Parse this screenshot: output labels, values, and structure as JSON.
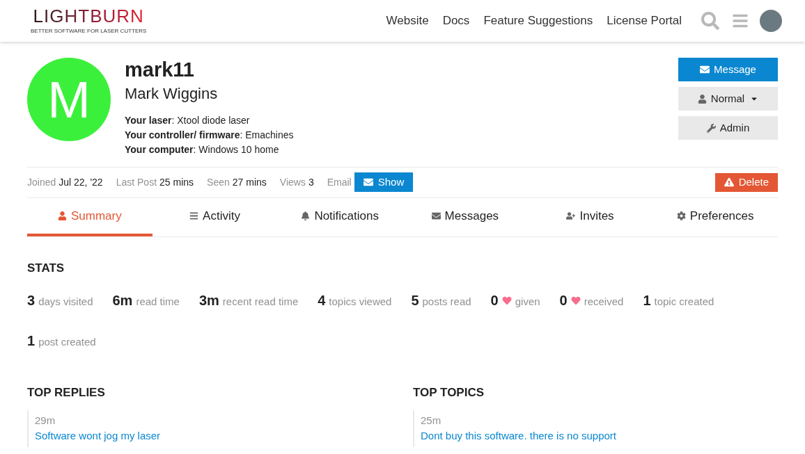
{
  "header": {
    "logo": {
      "name": "LIGHTBURN",
      "tagline": "BETTER SOFTWARE FOR LASER CUTTERS"
    },
    "nav": [
      "Website",
      "Docs",
      "Feature Suggestions",
      "License Portal"
    ]
  },
  "profile": {
    "avatar_letter": "M",
    "username": "mark11",
    "full_name": "Mark Wiggins",
    "fields": [
      "**Your laser**: Xtool diode laser",
      "**Your controller/ firmware**: Emachines",
      "**Your computer**: Windows 10 home"
    ],
    "actions": [
      {
        "label": "Message",
        "kind": "primary"
      },
      {
        "label": "Normal",
        "kind": "dropdown"
      },
      {
        "label": "Admin",
        "kind": "plain"
      }
    ]
  },
  "meta": [
    {
      "label": "Joined",
      "value": "Jul 22, '22"
    },
    {
      "label": "Last Post",
      "value": "25 mins"
    },
    {
      "label": "Seen",
      "value": "27 mins"
    },
    {
      "label": "Views",
      "value": "3"
    }
  ],
  "email": {
    "label": "Email",
    "button": "Show"
  },
  "delete_button": "Delete",
  "tabs": [
    {
      "label": "Summary",
      "selected": true
    },
    {
      "label": "Activity",
      "selected": false
    },
    {
      "label": "Notifications",
      "selected": false
    },
    {
      "label": "Messages",
      "selected": false
    },
    {
      "label": "Invites",
      "selected": false
    },
    {
      "label": "Preferences",
      "selected": false
    }
  ],
  "stats": {
    "title": "STATS",
    "items": [
      {
        "count": "3",
        "caption": "days visited",
        "kind": "plain"
      },
      {
        "count": "6m",
        "caption": "read time",
        "kind": "plain"
      },
      {
        "count": "3m",
        "caption": "recent read time",
        "kind": "plain"
      },
      {
        "count": "4",
        "caption": "topics viewed",
        "kind": "plain"
      },
      {
        "count": "5",
        "caption": "posts read",
        "kind": "plain"
      },
      {
        "count": "0",
        "caption": "given",
        "kind": "likes"
      },
      {
        "count": "0",
        "caption": "received",
        "kind": "likes"
      },
      {
        "count": "1",
        "caption": "topic created",
        "kind": "plain"
      },
      {
        "count": "1",
        "caption": "post created",
        "kind": "plain"
      }
    ]
  },
  "top_replies": {
    "title": "TOP REPLIES",
    "items": [
      {
        "time": "29m",
        "title": "Software wont jog my laser"
      }
    ]
  },
  "top_topics": {
    "title": "TOP TOPICS",
    "items": [
      {
        "time": "25m",
        "title": "Dont buy this software. there is no support"
      }
    ]
  }
}
